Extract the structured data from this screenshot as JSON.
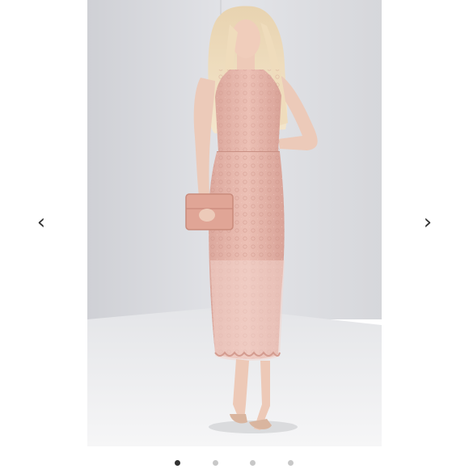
{
  "carousel": {
    "prev_arrow": "‹",
    "next_arrow": "›",
    "total_slides": 4,
    "active_slide": 1
  },
  "photo": {
    "subject": "model-in-blush-lace-midi-dress",
    "icon": "watermark-logo-icon"
  },
  "colors": {
    "background": "#ffffff",
    "dot_active": "#333333",
    "dot_inactive": "#c8c8c8",
    "dress": "#e7b7ac",
    "wall": "#dcdde1",
    "floor": "#f1f1f2"
  }
}
